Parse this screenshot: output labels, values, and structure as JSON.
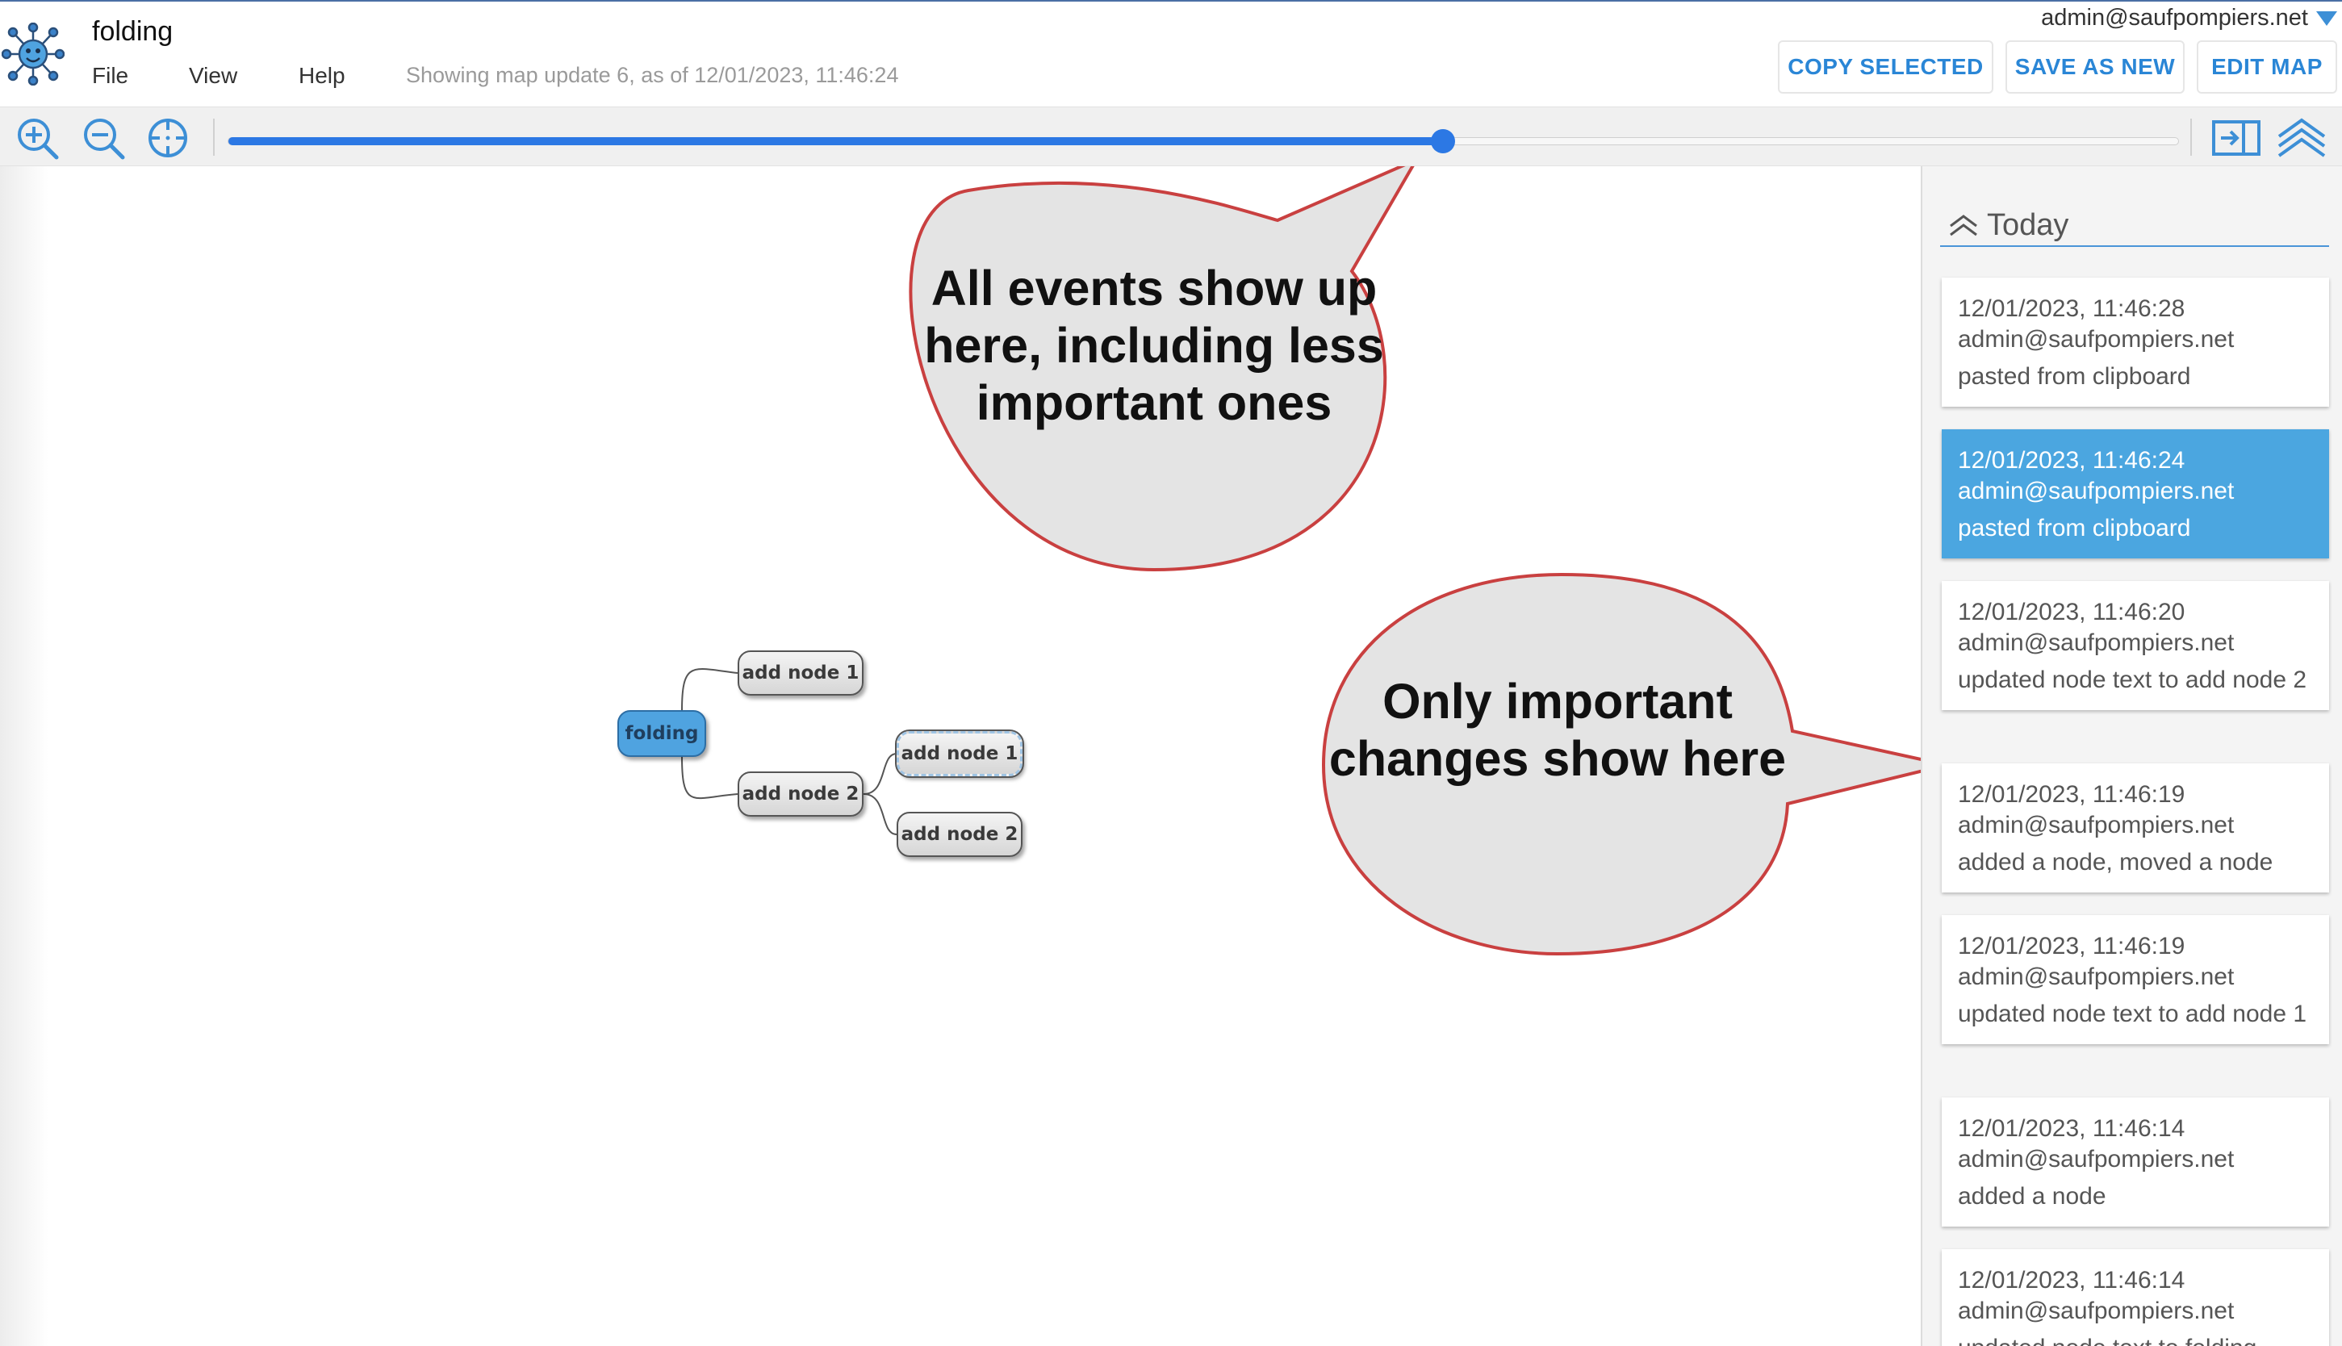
{
  "app": {
    "logo_icon": "bug-logo-icon",
    "map_title": "folding"
  },
  "menu": {
    "file": "File",
    "view": "View",
    "help": "Help"
  },
  "status": "Showing map update 6, as of 12/01/2023, 11:46:24",
  "user": {
    "email": "admin@saufpompiers.net",
    "caret_icon": "caret-down-icon"
  },
  "buttons": {
    "copy_selected": "COPY SELECTED",
    "save_as_new": "SAVE AS NEW",
    "edit_map": "EDIT MAP"
  },
  "toolbar": {
    "icons": [
      "zoom-in-icon",
      "zoom-out-icon",
      "center-map-icon",
      "split-view-icon",
      "collapse-all-icon"
    ],
    "timeline_progress": 0.623
  },
  "mindmap": {
    "root": "folding",
    "nodes": [
      "add node 1",
      "add node 2",
      "add node 1",
      "add node 2"
    ]
  },
  "callouts": [
    {
      "text": "All events show up here, including less important ones"
    },
    {
      "text": "Only important changes show here"
    }
  ],
  "history": {
    "section_title": "Today",
    "events": [
      {
        "time": "12/01/2023, 11:46:28",
        "user": "admin@saufpompiers.net",
        "desc": "pasted from clipboard",
        "selected": false
      },
      {
        "time": "12/01/2023, 11:46:24",
        "user": "admin@saufpompiers.net",
        "desc": "pasted from clipboard",
        "selected": true
      },
      {
        "time": "12/01/2023, 11:46:20",
        "user": "admin@saufpompiers.net",
        "desc": "updated node text to add node 2",
        "selected": false
      },
      {
        "time": "12/01/2023, 11:46:19",
        "user": "admin@saufpompiers.net",
        "desc": "added a node, moved a node",
        "selected": false
      },
      {
        "time": "12/01/2023, 11:46:19",
        "user": "admin@saufpompiers.net",
        "desc": "updated node text to add node 1",
        "selected": false
      },
      {
        "time": "12/01/2023, 11:46:14",
        "user": "admin@saufpompiers.net",
        "desc": "added a node",
        "selected": false
      },
      {
        "time": "12/01/2023, 11:46:14",
        "user": "admin@saufpompiers.net",
        "desc": "updated node text to folding",
        "selected": false
      }
    ]
  },
  "colors": {
    "accent": "#2c78e4",
    "selected_event": "#4ba6e0",
    "root_node": "#4fa3e0",
    "callout_fill": "#e4e4e4",
    "callout_stroke": "#c94040"
  }
}
